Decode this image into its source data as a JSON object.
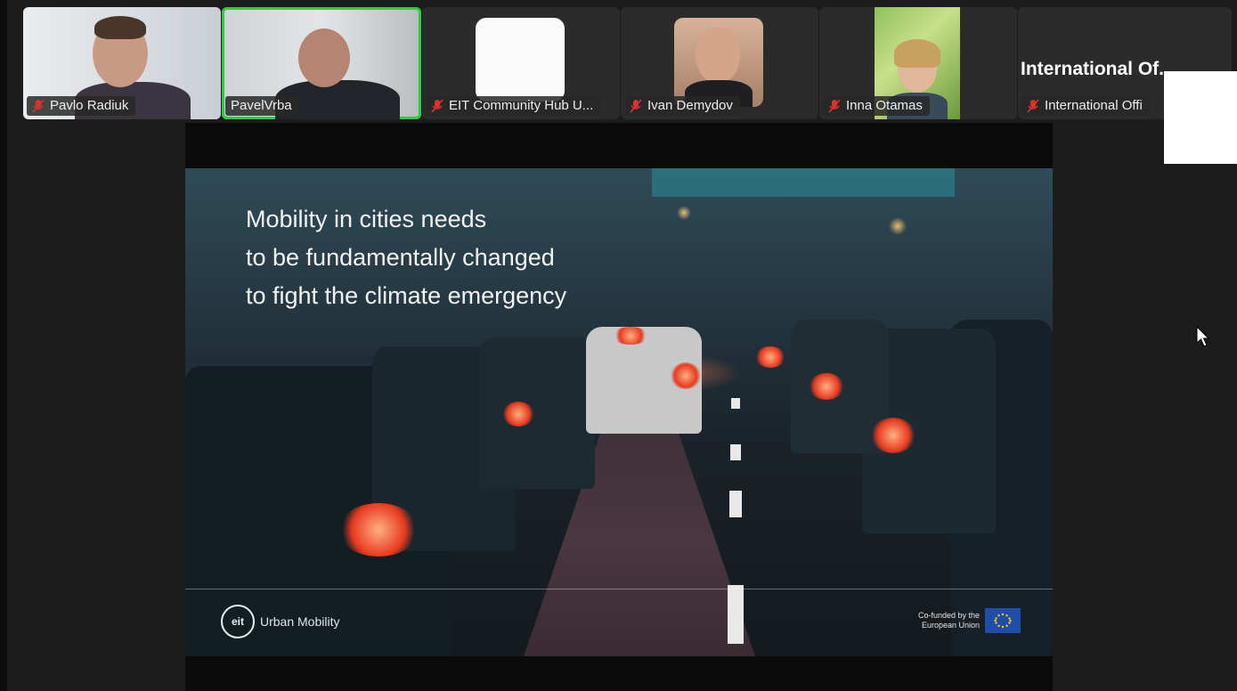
{
  "participants": [
    {
      "name": "Pavlo Radiuk",
      "muted": true,
      "active": false
    },
    {
      "name": "PavelVrba",
      "muted": false,
      "active": true
    },
    {
      "name": "EIT Community Hub U...",
      "muted": true,
      "active": false
    },
    {
      "name": "Ivan Demydov",
      "muted": true,
      "active": false
    },
    {
      "name": "Inna Otamas",
      "muted": true,
      "active": false
    },
    {
      "name": "International Offi",
      "title": "International  Of...",
      "muted": true,
      "active": false
    }
  ],
  "slide": {
    "lines": [
      "Mobility in cities needs",
      "to be fundamentally changed",
      "to fight the climate emergency"
    ],
    "logo_mark": "eit",
    "logo_text": "Urban Mobility",
    "cofund_line1": "Co-funded by the",
    "cofund_line2": "European Union"
  },
  "colors": {
    "active_speaker": "#2ecc40",
    "muted_icon": "#e03030",
    "eu_blue": "#1f4ea8"
  }
}
